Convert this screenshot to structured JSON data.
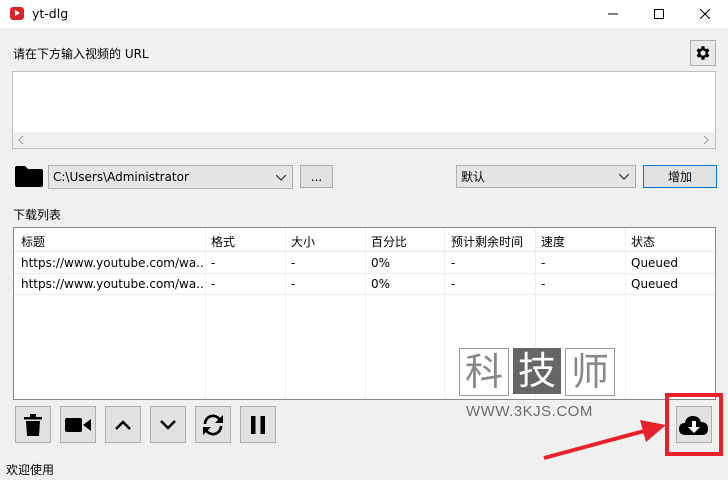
{
  "window": {
    "title": "yt-dlg"
  },
  "url_prompt": "请在下方输入视频的 URL",
  "path": {
    "value": "C:\\Users\\Administrator",
    "browse_label": "..."
  },
  "format": {
    "value": "默认"
  },
  "add_button": "增加",
  "download_list_label": "下载列表",
  "table": {
    "headers": [
      "标题",
      "格式",
      "大小",
      "百分比",
      "预计剩余时间",
      "速度",
      "状态"
    ],
    "rows": [
      [
        "https://www.youtube.com/wa...",
        "-",
        "-",
        "0%",
        "-",
        "-",
        "Queued"
      ],
      [
        "https://www.youtube.com/wa...",
        "-",
        "-",
        "0%",
        "-",
        "-",
        "Queued"
      ]
    ]
  },
  "watermark": {
    "chars": [
      "科",
      "技",
      "师"
    ],
    "url": "WWW.3KJS.COM"
  },
  "status_bar": "欢迎使用",
  "colors": {
    "highlight": "#e8222a",
    "accent_border": "#0078d7"
  }
}
